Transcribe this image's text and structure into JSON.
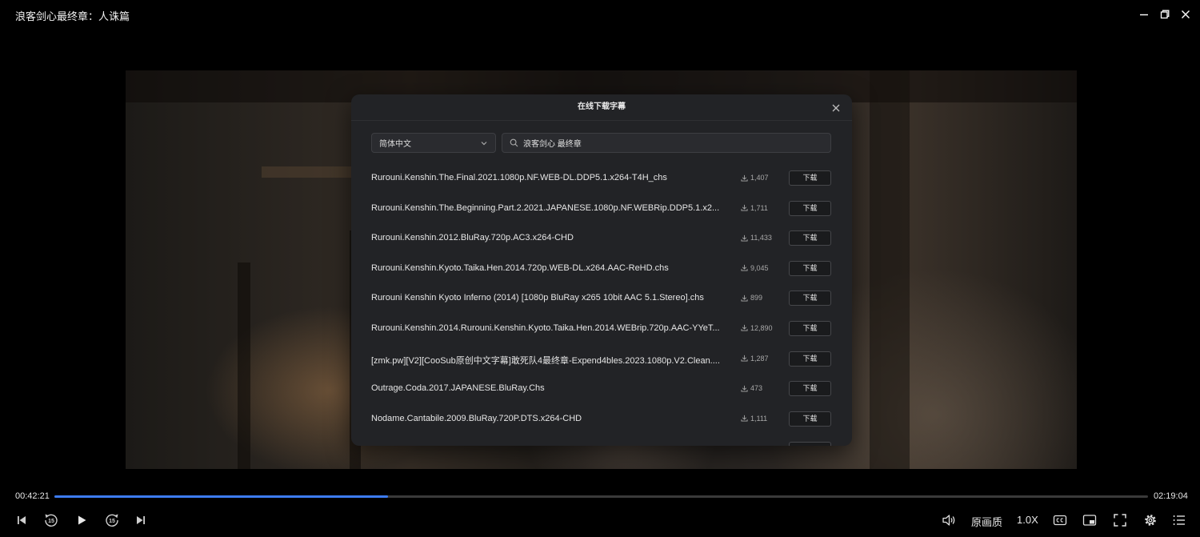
{
  "window": {
    "title": "浪客剑心最终章：人诛篇",
    "controls": [
      "minimize-icon",
      "restore-icon",
      "close-icon"
    ]
  },
  "dialog": {
    "title": "在线下载字幕",
    "language_select": {
      "value": "简体中文"
    },
    "search": {
      "value": "浪客剑心 最终章"
    },
    "download_label": "下载",
    "items": [
      {
        "name": "Rurouni.Kenshin.The.Final.2021.1080p.NF.WEB-DL.DDP5.1.x264-T4H_chs",
        "count": "1,407"
      },
      {
        "name": "Rurouni.Kenshin.The.Beginning.Part.2.2021.JAPANESE.1080p.NF.WEBRip.DDP5.1.x2...",
        "count": "1,711"
      },
      {
        "name": "Rurouni.Kenshin.2012.BluRay.720p.AC3.x264-CHD",
        "count": "11,433"
      },
      {
        "name": "Rurouni.Kenshin.Kyoto.Taika.Hen.2014.720p.WEB-DL.x264.AAC-ReHD.chs",
        "count": "9,045"
      },
      {
        "name": "Rurouni Kenshin Kyoto Inferno (2014) [1080p BluRay x265 10bit AAC 5.1.Stereo].chs",
        "count": "899"
      },
      {
        "name": "Rurouni.Kenshin.2014.Rurouni.Kenshin.Kyoto.Taika.Hen.2014.WEBrip.720p.AAC-YYeT...",
        "count": "12,890"
      },
      {
        "name": "[zmk.pw][V2][CooSub原创中文字幕]敢死队4最终章-Expend4bles.2023.1080p.V2.Clean....",
        "count": "1,287"
      },
      {
        "name": "Outrage.Coda.2017.JAPANESE.BluRay.Chs",
        "count": "473"
      },
      {
        "name": "Nodame.Cantabile.2009.BluRay.720P.DTS.x264-CHD",
        "count": "1,111"
      }
    ]
  },
  "player": {
    "current_time": "00:42:21",
    "duration": "02:19:04",
    "progress_fraction": 0.305,
    "accent_color": "#3d7cf5",
    "skip_back_seconds": "15",
    "skip_forward_seconds": "15",
    "quality_label": "原画质",
    "speed_label": "1.0X"
  }
}
